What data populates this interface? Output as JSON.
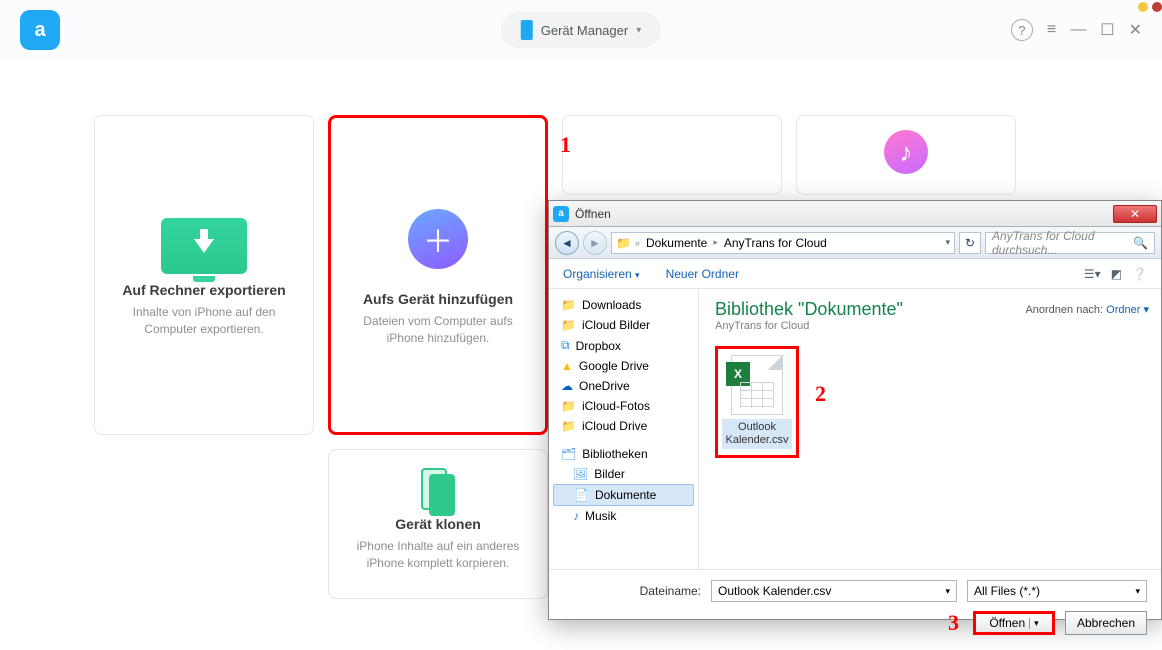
{
  "topbar": {
    "device_label": "Gerät Manager"
  },
  "cards": {
    "export": {
      "title": "Auf Rechner exportieren",
      "desc": "Inhalte von iPhone auf den Computer exportieren."
    },
    "add": {
      "title": "Aufs Gerät hinzufügen",
      "desc": "Dateien vom Computer aufs iPhone hinzufügen."
    },
    "clone": {
      "title": "Gerät klonen",
      "desc": "iPhone Inhalte auf ein anderes iPhone komplett korpieren."
    }
  },
  "dialog": {
    "title": "Öffnen",
    "breadcrumb": [
      "Dokumente",
      "AnyTrans for Cloud"
    ],
    "search_placeholder": "AnyTrans for Cloud durchsuch...",
    "toolbar": {
      "organize": "Organisieren",
      "new_folder": "Neuer Ordner"
    },
    "tree": {
      "items": [
        "Downloads",
        "iCloud Bilder",
        "Dropbox",
        "Google Drive",
        "OneDrive",
        "iCloud-Fotos",
        "iCloud Drive"
      ],
      "lib_header": "Bibliotheken",
      "lib_items": [
        "Bilder",
        "Dokumente",
        "Musik"
      ]
    },
    "content": {
      "heading": "Bibliothek \"Dokumente\"",
      "subheading": "AnyTrans for Cloud",
      "arrange_label": "Anordnen nach:",
      "arrange_value": "Ordner",
      "file_name": "Outlook Kalender.csv"
    },
    "footer": {
      "filename_label": "Dateiname:",
      "filename_value": "Outlook Kalender.csv",
      "filter_value": "All Files (*.*)",
      "open": "Öffnen",
      "cancel": "Abbrechen"
    }
  },
  "annotations": {
    "one": "1",
    "two": "2",
    "three": "3"
  }
}
